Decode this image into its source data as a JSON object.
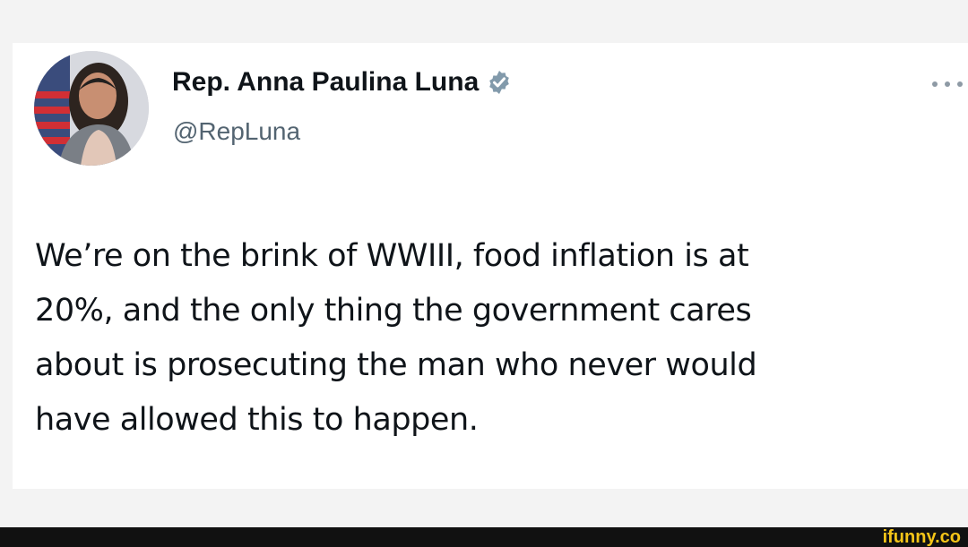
{
  "tweet": {
    "author": {
      "display_name": "Rep. Anna Paulina Luna",
      "handle": "@RepLuna",
      "verified_icon": "verified-badge-icon",
      "avatar": "profile-photo"
    },
    "more_icon": "more-options-icon",
    "text_lines": [
      "We’re on the brink of WWIII, food inflation is at",
      "20%, and the only thing the government cares",
      "about is prosecuting the man who never would",
      "have allowed this to happen."
    ]
  },
  "watermark": {
    "text": "ifunny.co"
  },
  "colors": {
    "text": "#0f1419",
    "handle": "#536471",
    "verified": "#829aab",
    "watermark": "#f5c518",
    "background": "#f3f3f3"
  }
}
